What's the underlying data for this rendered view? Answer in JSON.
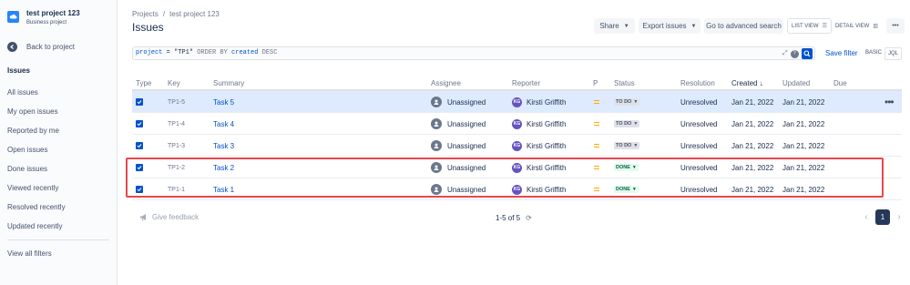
{
  "sidebar": {
    "project_name": "test project 123",
    "project_type": "Business project",
    "back_label": "Back to project",
    "section_heading": "Issues",
    "items": [
      "All issues",
      "My open issues",
      "Reported by me",
      "Open issues",
      "Done issues",
      "Viewed recently",
      "Resolved recently",
      "Updated recently"
    ],
    "footer": "View all filters"
  },
  "header": {
    "breadcrumb_root": "Projects",
    "breadcrumb_sep": "/",
    "breadcrumb_project": "test project 123",
    "title": "Issues",
    "share_label": "Share",
    "export_label": "Export issues",
    "advanced_label": "Go to advanced search",
    "list_view_label": "LIST VIEW",
    "detail_view_label": "DETAIL VIEW",
    "more_label": "•••"
  },
  "jql": {
    "field": "project",
    "op": " = ",
    "value": "\"TP1\"",
    "order": " ORDER BY ",
    "sort_field": "created",
    "dir": " DESC",
    "save_filter": "Save filter",
    "basic_label": "BASIC",
    "jql_label": "JQL",
    "help": "?"
  },
  "columns": {
    "type": "Type",
    "key": "Key",
    "summary": "Summary",
    "assignee": "Assignee",
    "reporter": "Reporter",
    "priority": "P",
    "status": "Status",
    "resolution": "Resolution",
    "created": "Created",
    "created_sort": "↓",
    "updated": "Updated",
    "due": "Due"
  },
  "rows": [
    {
      "key": "TP1-5",
      "summary": "Task 5",
      "assignee": "Unassigned",
      "reporter": "Kirsti Griffith",
      "reporter_initials": "KG",
      "status": "TO DO",
      "resolution": "Unresolved",
      "created": "Jan 21, 2022",
      "updated": "Jan 21, 2022"
    },
    {
      "key": "TP1-4",
      "summary": "Task 4",
      "assignee": "Unassigned",
      "reporter": "Kirsti Griffith",
      "reporter_initials": "KG",
      "status": "TO DO",
      "resolution": "Unresolved",
      "created": "Jan 21, 2022",
      "updated": "Jan 21, 2022"
    },
    {
      "key": "TP1-3",
      "summary": "Task 3",
      "assignee": "Unassigned",
      "reporter": "Kirsti Griffith",
      "reporter_initials": "KG",
      "status": "TO DO",
      "resolution": "Unresolved",
      "created": "Jan 21, 2022",
      "updated": "Jan 21, 2022"
    },
    {
      "key": "TP1-2",
      "summary": "Task 2",
      "assignee": "Unassigned",
      "reporter": "Kirsti Griffith",
      "reporter_initials": "KG",
      "status": "DONE",
      "resolution": "Unresolved",
      "created": "Jan 21, 2022",
      "updated": "Jan 21, 2022"
    },
    {
      "key": "TP1-1",
      "summary": "Task 1",
      "assignee": "Unassigned",
      "reporter": "Kirsti Griffith",
      "reporter_initials": "KG",
      "status": "DONE",
      "resolution": "Unresolved",
      "created": "Jan 21, 2022",
      "updated": "Jan 21, 2022"
    }
  ],
  "row_more": "•••",
  "footer": {
    "feedback": "Give feedback",
    "count": "1-5 of 5",
    "page": "1",
    "prev": "‹",
    "next": "›"
  },
  "colors": {
    "accent": "#0052CC",
    "selected_row": "#DEEBFF",
    "highlight_box": "#E5484D",
    "priority_medium": "#FFAB00",
    "done_bg": "#E3FCEF",
    "todo_bg": "#DFE1E6"
  }
}
